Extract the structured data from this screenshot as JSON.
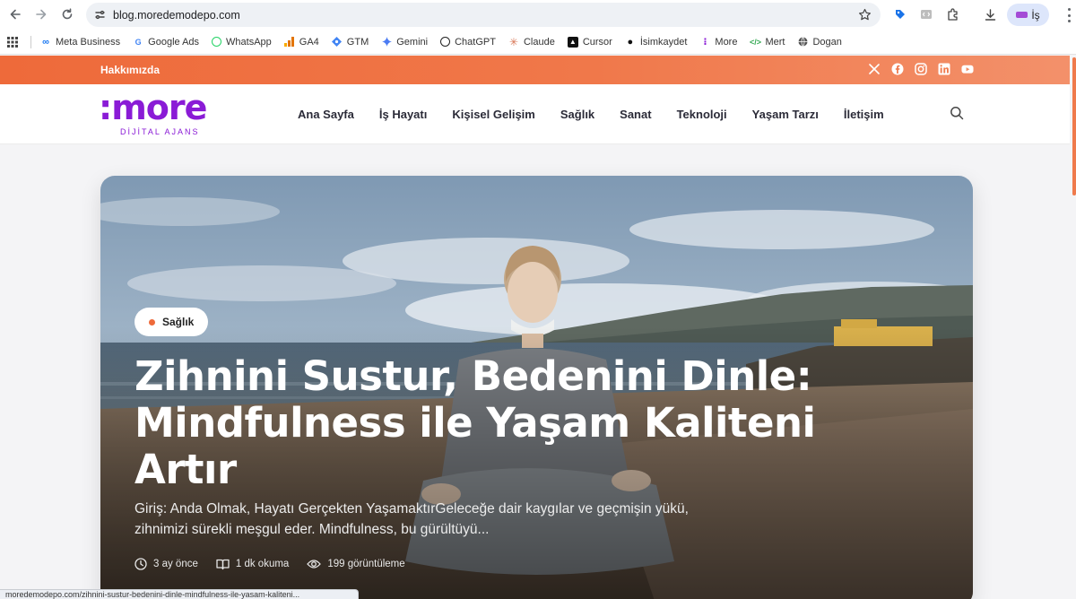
{
  "browser": {
    "url": "blog.moredemodepo.com",
    "profile_label": "İş",
    "bookmarks": [
      {
        "label": "Meta Business",
        "icon": "meta-icon"
      },
      {
        "label": "Google Ads",
        "icon": "google-icon"
      },
      {
        "label": "WhatsApp",
        "icon": "whatsapp-icon"
      },
      {
        "label": "GA4",
        "icon": "ga4-icon"
      },
      {
        "label": "GTM",
        "icon": "gtm-icon"
      },
      {
        "label": "Gemini",
        "icon": "gemini-icon"
      },
      {
        "label": "ChatGPT",
        "icon": "chatgpt-icon"
      },
      {
        "label": "Claude",
        "icon": "claude-icon"
      },
      {
        "label": "Cursor",
        "icon": "cursor-icon"
      },
      {
        "label": "İsimkaydet",
        "icon": "isimkaydet-icon"
      },
      {
        "label": "More",
        "icon": "more-icon"
      },
      {
        "label": "Mert",
        "icon": "code-icon"
      },
      {
        "label": "Dogan",
        "icon": "globe-icon"
      }
    ],
    "status_url": "moredemodepo.com/zihnini-sustur-bedenini-dinle-mindfulness-ile-yasam-kaliteni..."
  },
  "site": {
    "topbar": {
      "about_label": "Hakkımızda",
      "socials": [
        "x-icon",
        "facebook-icon",
        "instagram-icon",
        "linkedin-icon",
        "youtube-icon"
      ],
      "color": "#ee6a3a"
    },
    "logo": {
      "word": ":more",
      "sub": "DİJİTAL AJANS",
      "color": "#8a1bd6"
    },
    "menu": [
      "Ana Sayfa",
      "İş Hayatı",
      "Kişisel Gelişim",
      "Sağlık",
      "Sanat",
      "Teknoloji",
      "Yaşam Tarzı",
      "İletişim"
    ]
  },
  "hero": {
    "category": "Sağlık",
    "title": "Zihnini Sustur, Bedenini Dinle: Mindfulness ile Yaşam Kaliteni Artır",
    "excerpt": "Giriş: Anda Olmak, Hayatı Gerçekten YaşamaktırGeleceğe dair kaygılar ve geçmişin yükü, zihnimizi sürekli meşgul eder. Mindfulness, bu gürültüyü...",
    "meta": {
      "time_ago": "3 ay önce",
      "read_time": "1 dk okuma",
      "views": "199 görüntüleme"
    }
  }
}
